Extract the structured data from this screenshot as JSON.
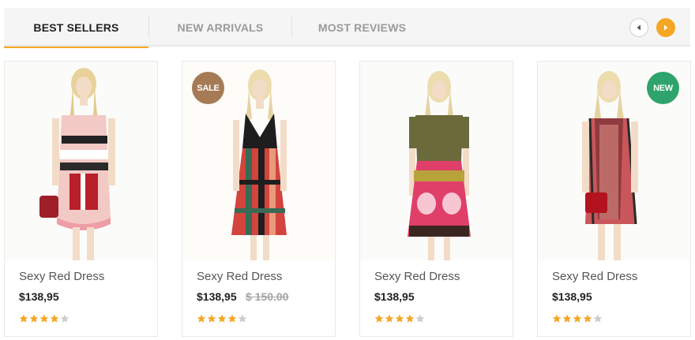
{
  "tabs": [
    {
      "label": "BEST SELLERS",
      "active": true
    },
    {
      "label": "NEW ARRIVALS",
      "active": false
    },
    {
      "label": "MOST REVIEWS",
      "active": false
    }
  ],
  "carousel": {
    "prev_icon": "caret-left-icon",
    "next_icon": "caret-right-icon",
    "accent": "#f5a623"
  },
  "products": [
    {
      "name": "Sexy Red Dress",
      "price": "$138,95",
      "old_price": "",
      "badge": "",
      "rating": 4,
      "rating_max": 5
    },
    {
      "name": "Sexy Red Dress",
      "price": "$138,95",
      "old_price": "$ 150.00",
      "badge": "SALE",
      "badge_color": "#a57a55",
      "rating": 4,
      "rating_max": 5
    },
    {
      "name": "Sexy Red Dress",
      "price": "$138,95",
      "old_price": "",
      "badge": "",
      "rating": 4,
      "rating_max": 5
    },
    {
      "name": "Sexy Red Dress",
      "price": "$138,95",
      "old_price": "",
      "badge": "NEW",
      "badge_color": "#2ea36b",
      "rating": 4,
      "rating_max": 5
    }
  ],
  "colors": {
    "star_filled": "#f5a623",
    "star_empty": "#cccccc"
  }
}
